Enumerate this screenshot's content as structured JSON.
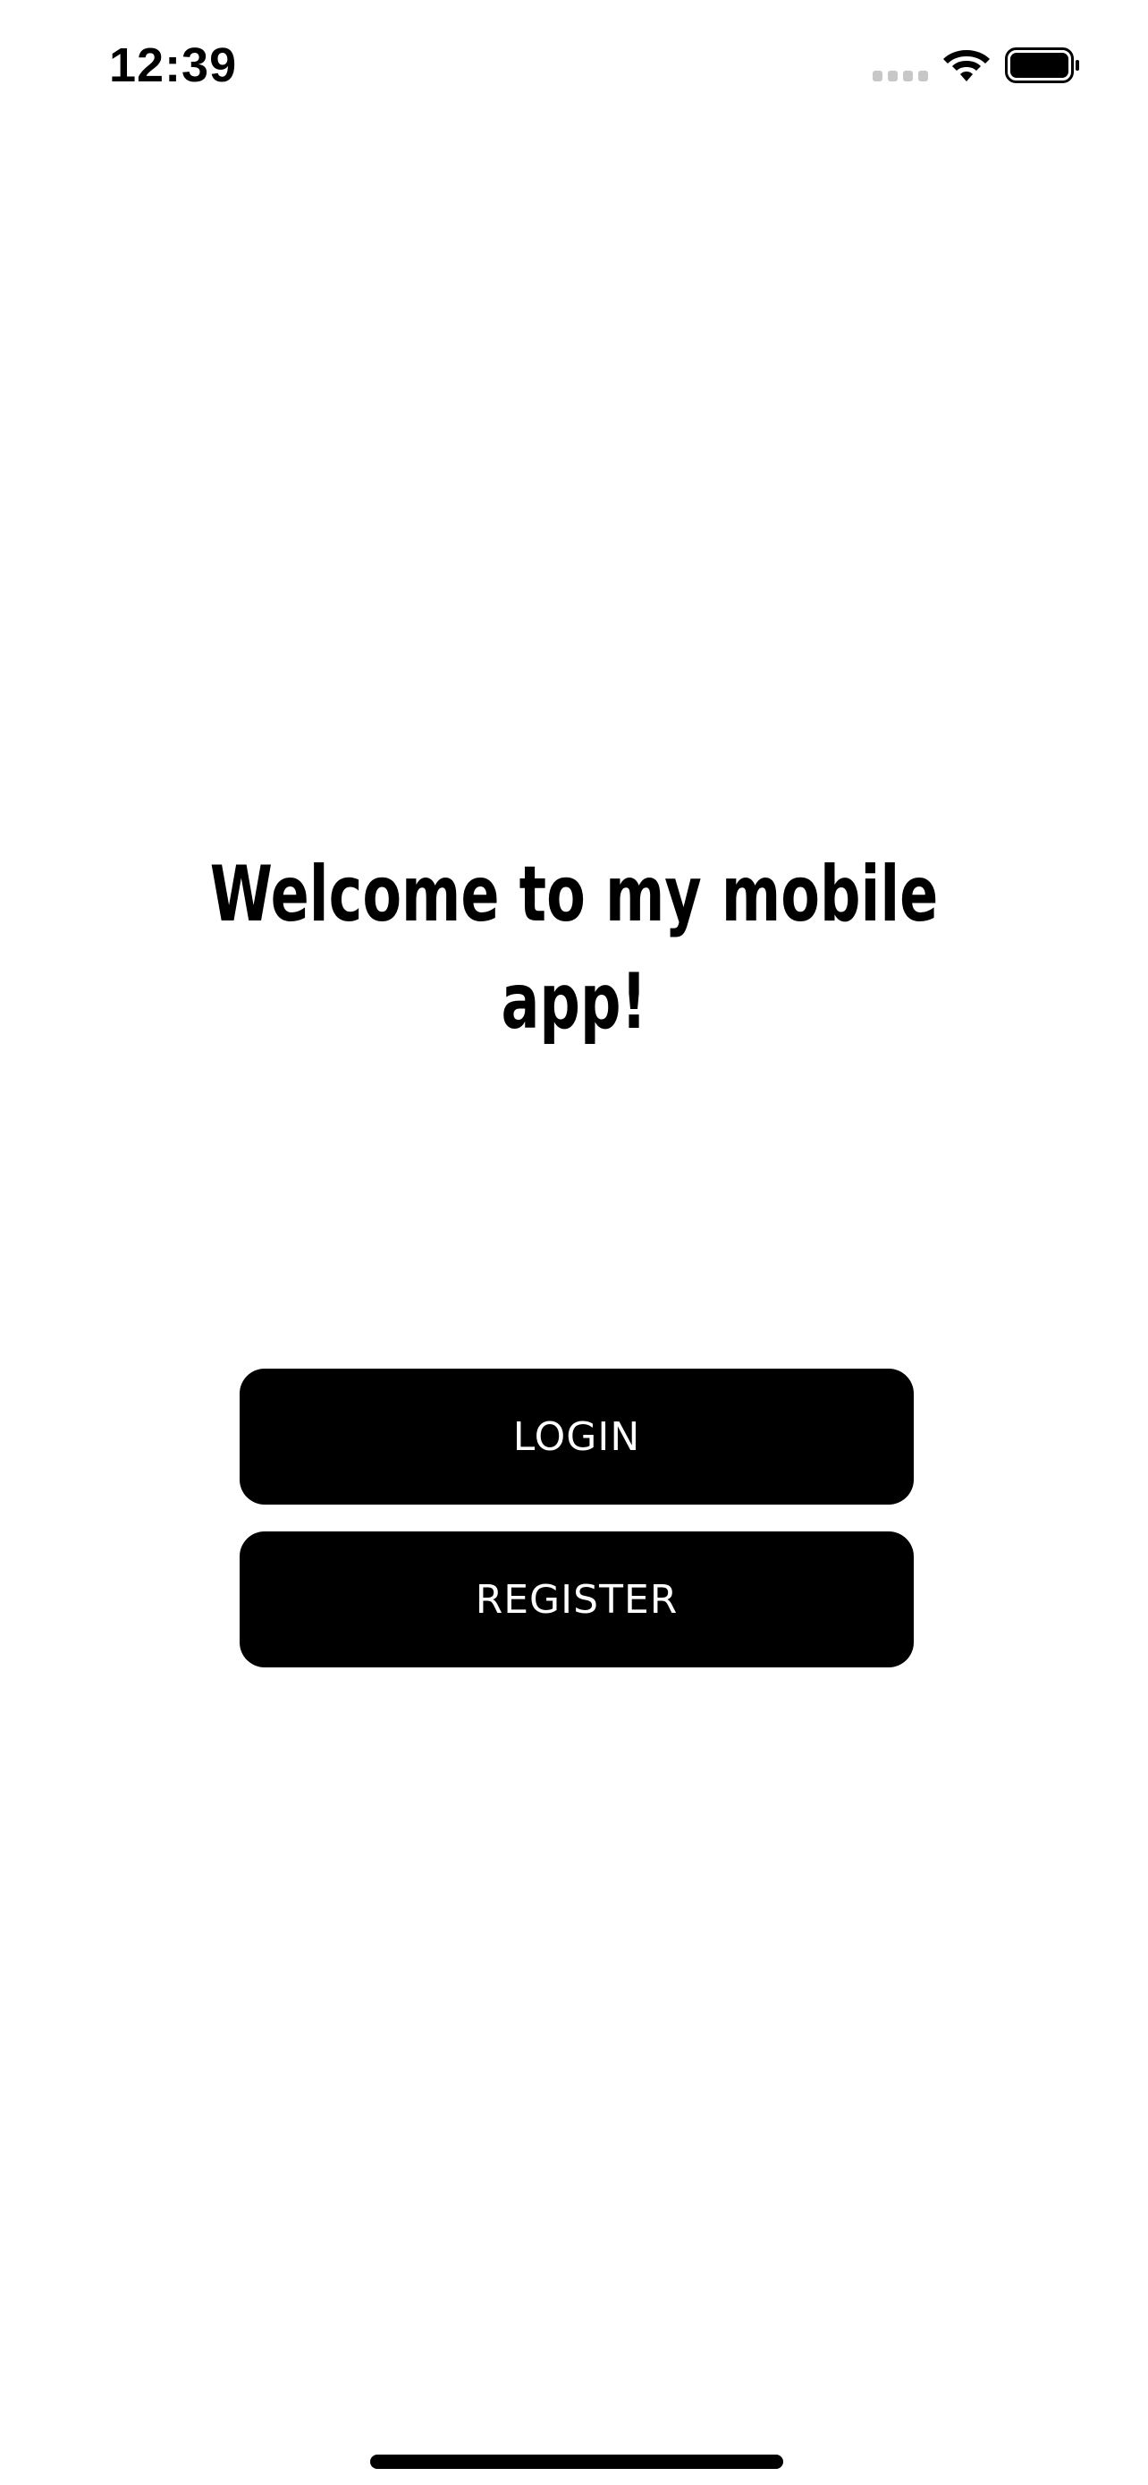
{
  "status_bar": {
    "time": "12:39",
    "icons": [
      "cellular-signal-icon",
      "wifi-icon",
      "battery-icon"
    ]
  },
  "main": {
    "title": "Welcome to my mobile app!",
    "buttons": {
      "login_label": "LOGIN",
      "register_label": "REGISTER"
    }
  },
  "colors": {
    "background": "#ffffff",
    "button_background": "#000000",
    "button_text": "#ffffff",
    "title_text": "#000000"
  }
}
